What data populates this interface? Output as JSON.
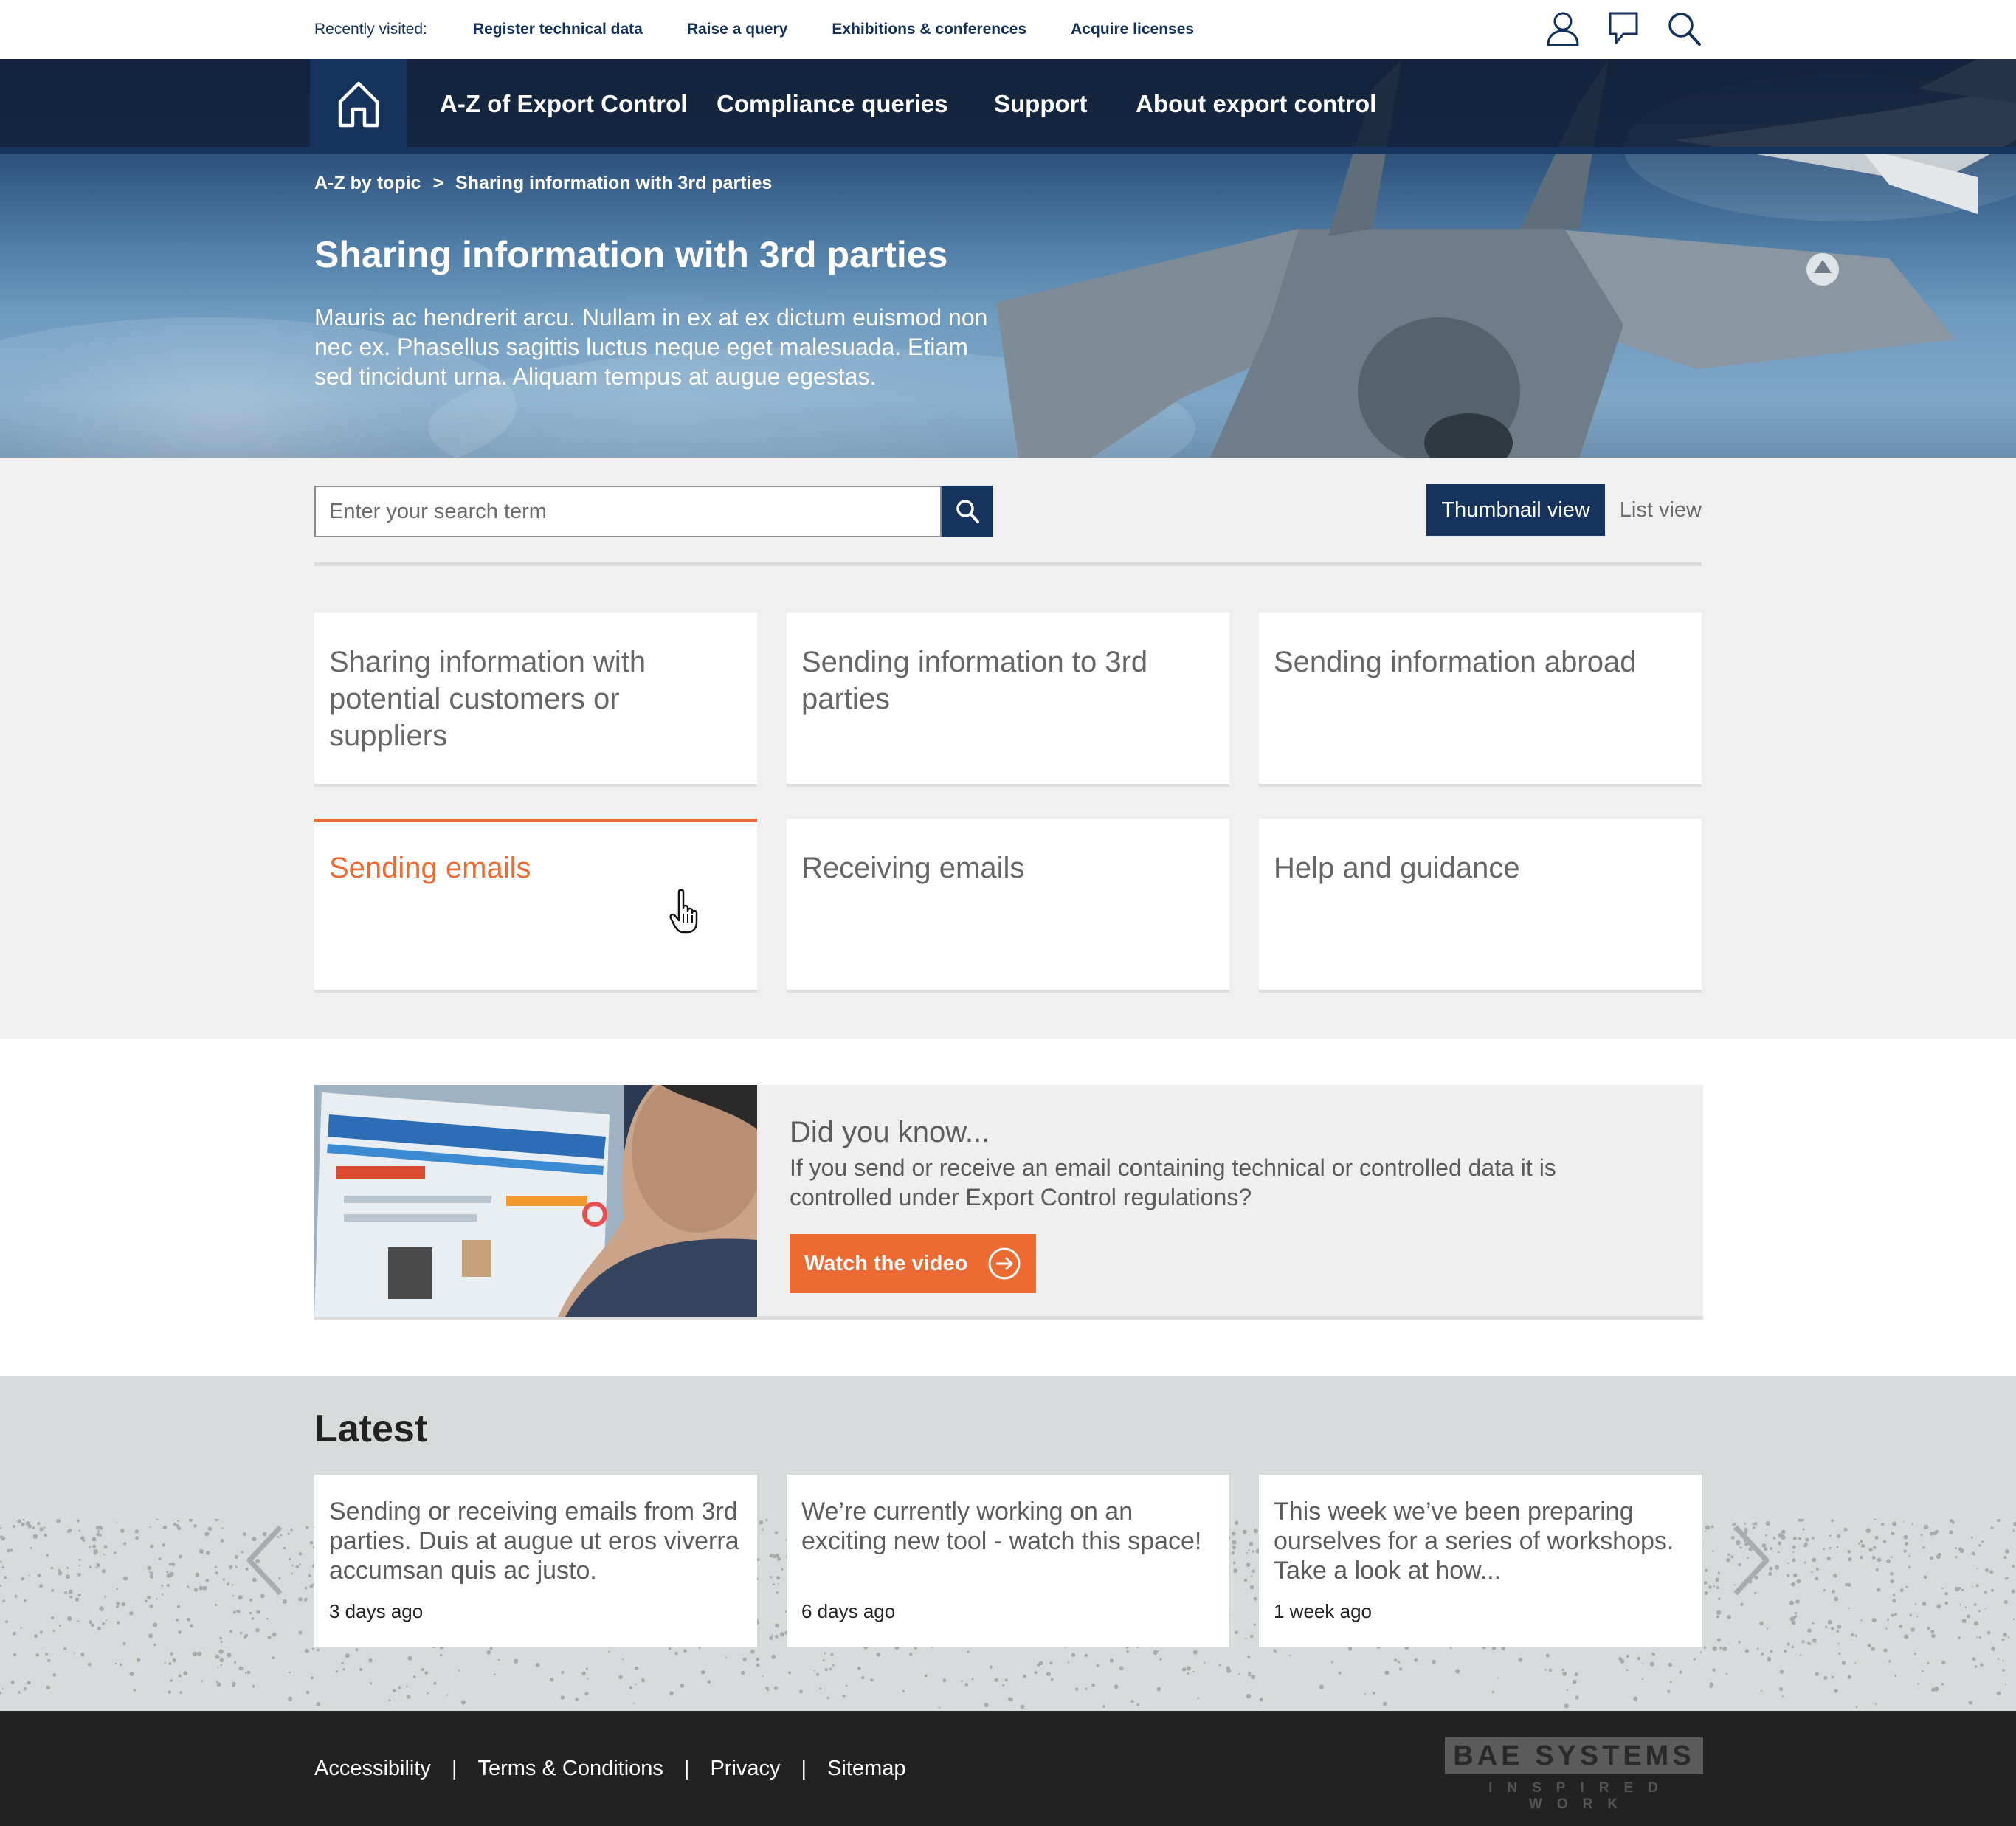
{
  "topbar": {
    "recent_label": "Recently visited:",
    "links": [
      "Register technical data",
      "Raise a query",
      "Exhibitions & conferences",
      "Acquire licenses"
    ],
    "icons": [
      "user-icon",
      "chat-icon",
      "search-icon"
    ]
  },
  "nav": {
    "home_icon": "home-icon",
    "items": [
      "A-Z of Export Control",
      "Compliance queries",
      "Support",
      "About export control"
    ]
  },
  "hero": {
    "breadcrumb": [
      "A-Z by topic",
      ">",
      "Sharing information with 3rd parties"
    ],
    "title": "Sharing information with 3rd parties",
    "description": "Mauris ac hendrerit arcu. Nullam in ex at ex dictum euismod non nec ex. Phasellus sagittis luctus neque eget malesuada. Etiam sed tincidunt urna. Aliquam tempus at augue egestas."
  },
  "search": {
    "placeholder": "Enter your search term",
    "value": ""
  },
  "view_toggle": {
    "thumbnail": "Thumbnail view",
    "list": "List view",
    "selected": "Thumbnail view"
  },
  "topics": [
    {
      "label": "Sharing information with potential customers or suppliers",
      "active": false
    },
    {
      "label": "Sending information to 3rd parties",
      "active": false
    },
    {
      "label": "Sending information abroad",
      "active": false
    },
    {
      "label": "Sending emails",
      "active": true
    },
    {
      "label": "Receiving emails",
      "active": false
    },
    {
      "label": "Help and guidance",
      "active": false
    }
  ],
  "did_you_know": {
    "title": "Did you know...",
    "text": "If you send or receive an email containing technical or controlled data it is controlled under Export Control regulations?",
    "button": "Watch the video",
    "button_icon": "arrow-right-circle-icon"
  },
  "latest": {
    "title": "Latest",
    "items": [
      {
        "text": "Sending or receiving emails from 3rd parties. Duis at augue ut eros viverra accumsan quis ac justo.",
        "date": "3 days ago"
      },
      {
        "text": "We’re currently working on an exciting new tool - watch this space!",
        "date": "6 days ago"
      },
      {
        "text": "This week we’ve been preparing ourselves for a series of workshops. Take a look at how...",
        "date": "1 week ago"
      }
    ]
  },
  "footer": {
    "links": [
      "Accessibility",
      "Terms & Conditions",
      "Privacy",
      "Sitemap"
    ],
    "separator": "|",
    "logo_name": "BAE SYSTEMS",
    "logo_tagline": "INSPIRED WORK"
  },
  "colors": {
    "navy": "#15335d",
    "accent": "#ed6a32",
    "footer": "#222222",
    "panel": "#f0f0f0"
  }
}
